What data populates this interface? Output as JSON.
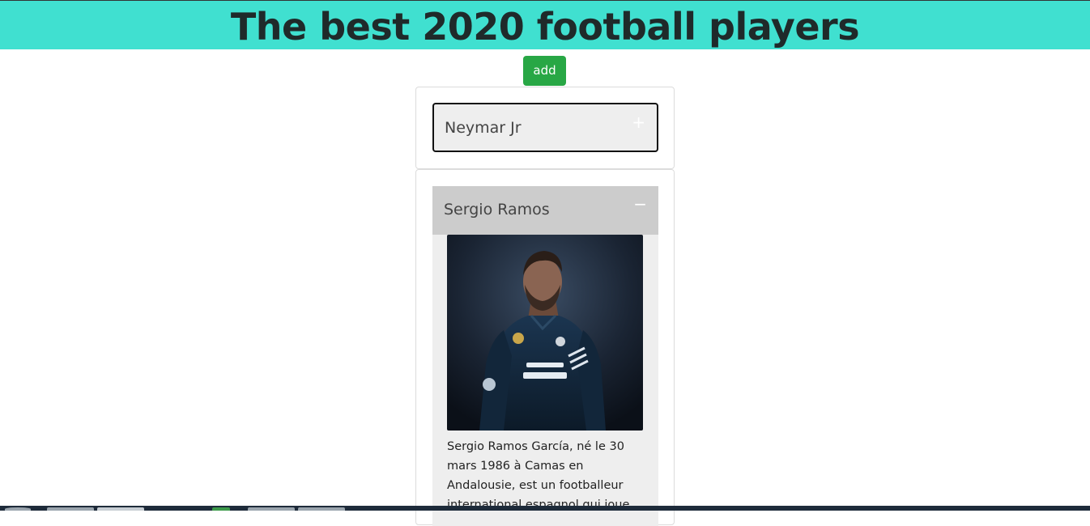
{
  "header": {
    "title": "The best 2020 football players"
  },
  "toolbar": {
    "add_label": "add"
  },
  "players": [
    {
      "name": "Neymar Jr",
      "toggle": "+",
      "expanded": false
    },
    {
      "name": "Sergio Ramos",
      "toggle": "−",
      "expanded": true,
      "bio": "Sergio Ramos García, né le 30 mars 1986 à Camas en Andalousie, est un footballeur international espagnol qui joue"
    }
  ],
  "colors": {
    "header_bg": "#40e0d0",
    "add_button": "#28a745",
    "expanded_header": "#cccccc",
    "collapsed_header": "#eeeeee"
  }
}
